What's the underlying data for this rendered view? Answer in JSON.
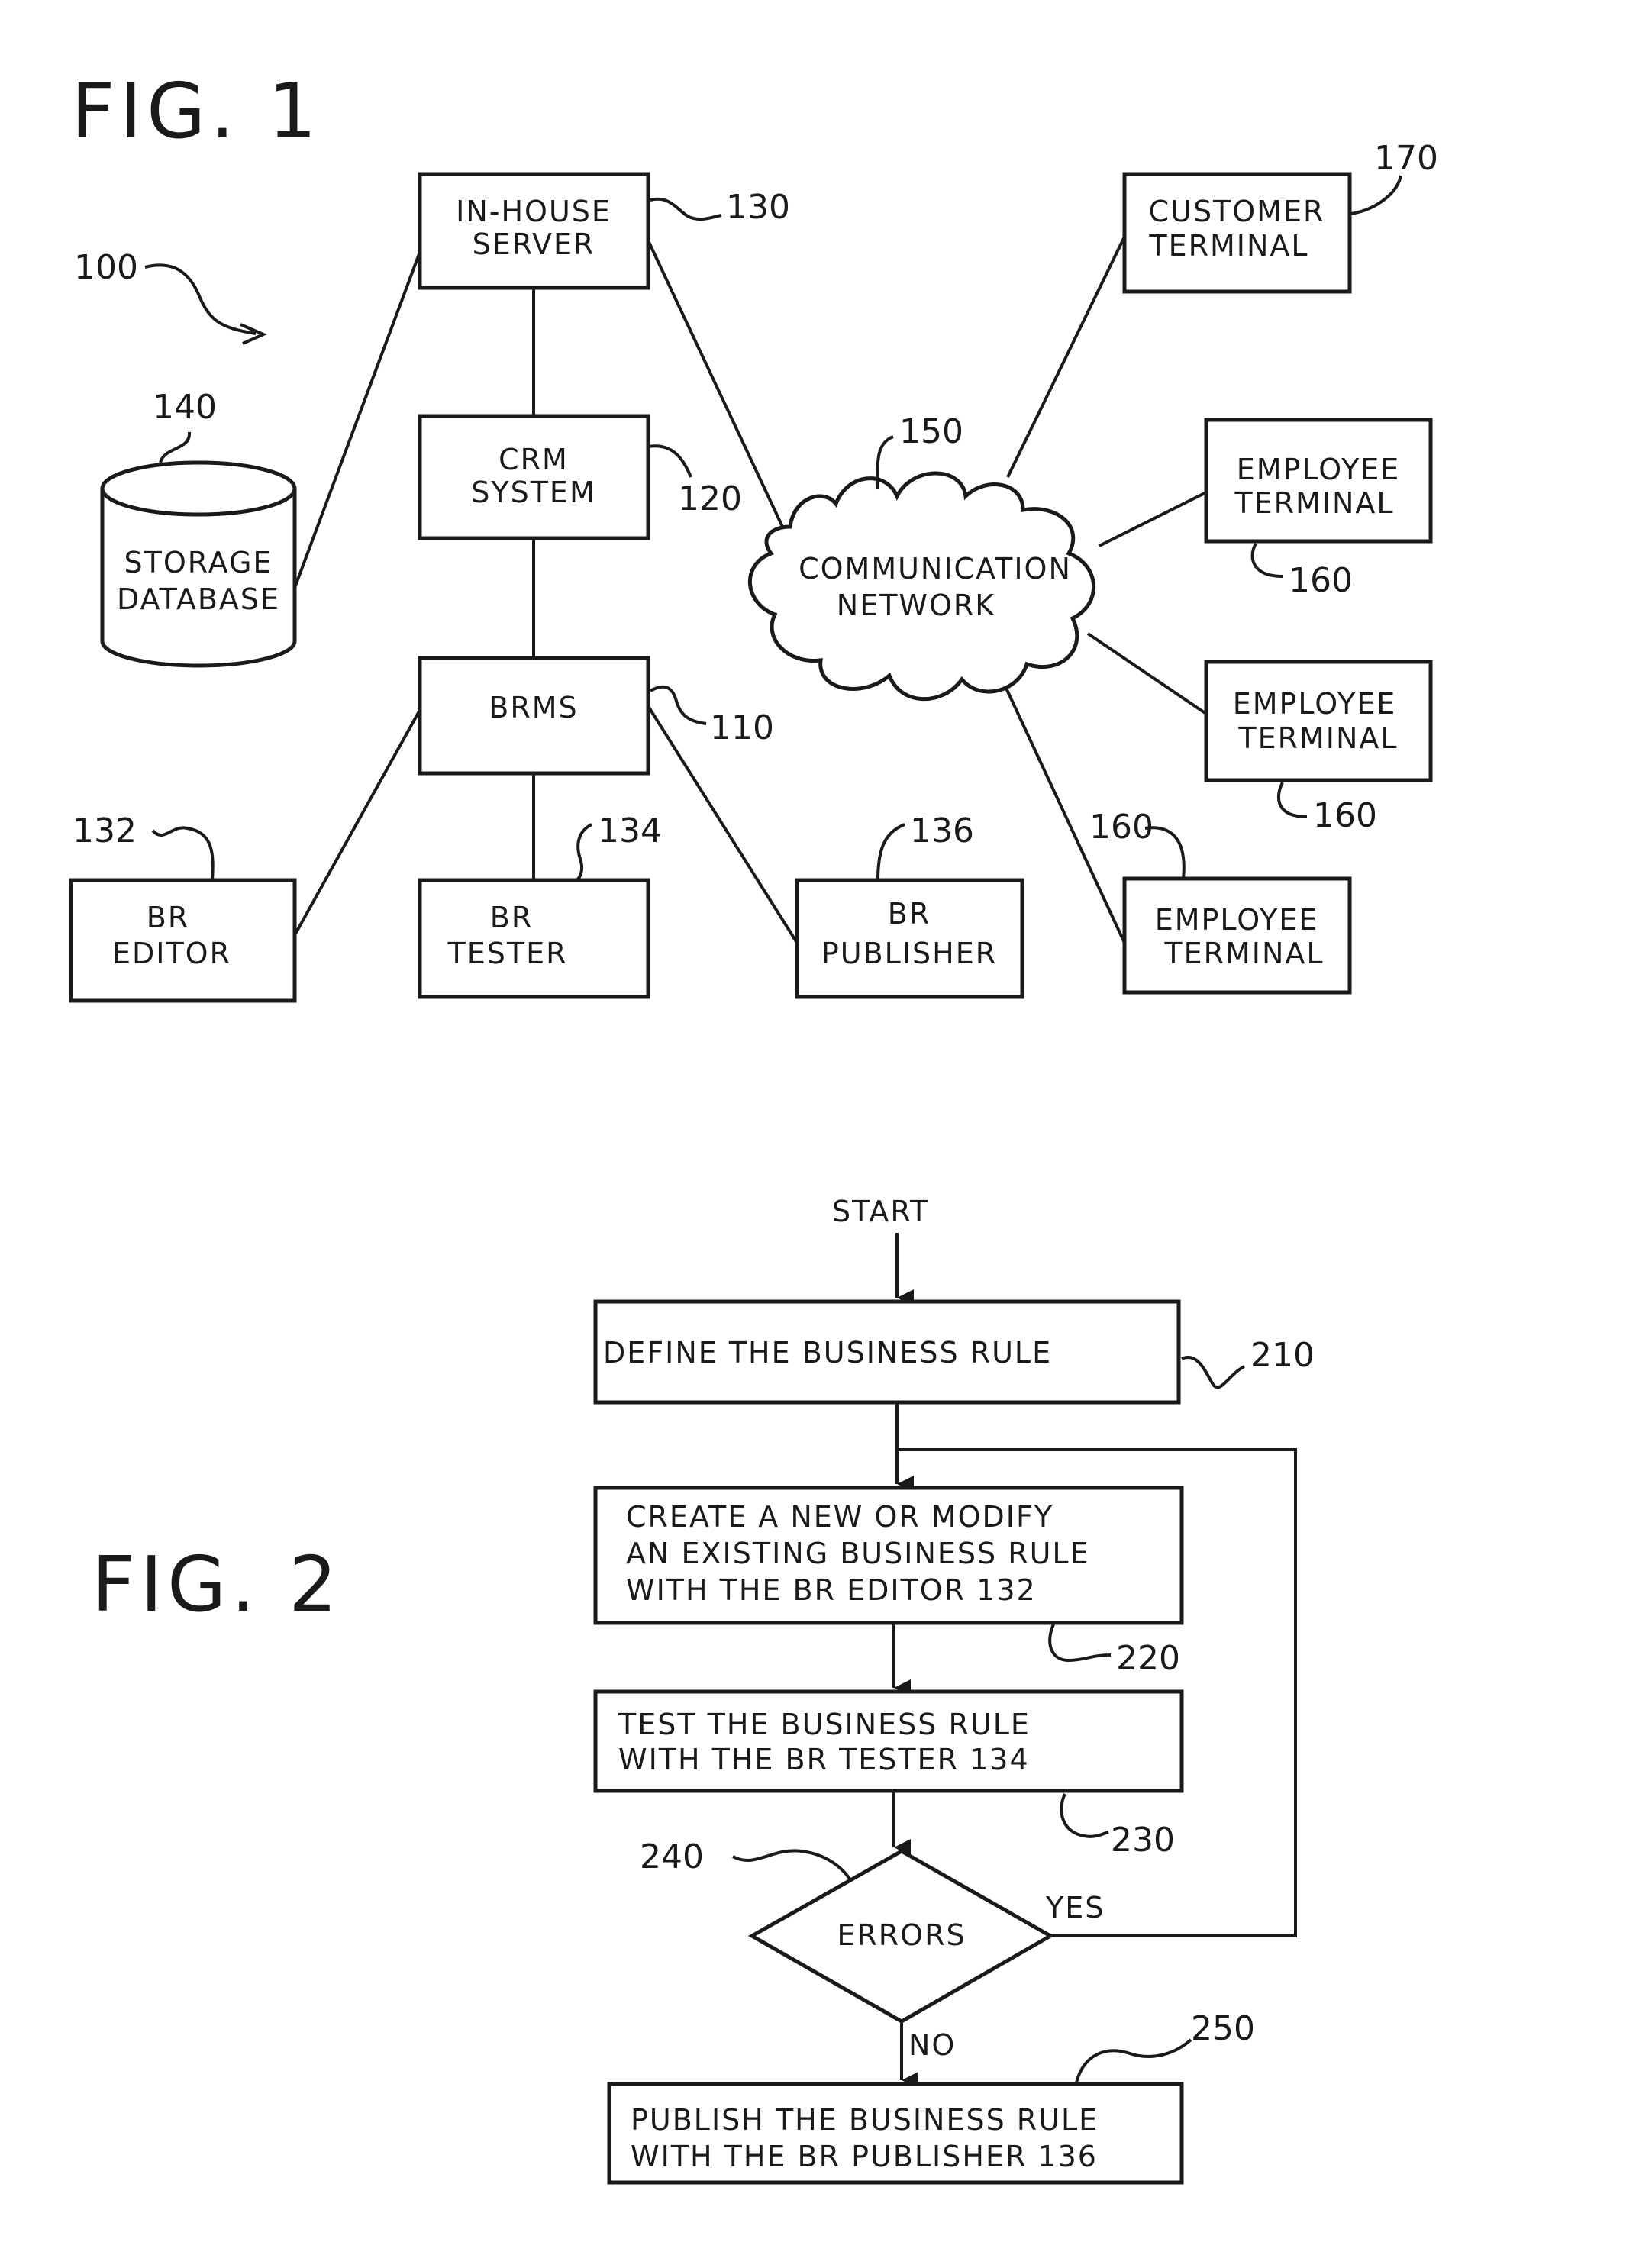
{
  "fig1": {
    "title": "FIG. 1",
    "system_ref": "100",
    "nodes": {
      "in_house_server": {
        "lines": [
          "IN-HOUSE",
          "SERVER"
        ],
        "ref": "130"
      },
      "crm_system": {
        "lines": [
          "CRM",
          "SYSTEM"
        ],
        "ref": "120"
      },
      "storage_database": {
        "lines": [
          "STORAGE",
          "DATABASE"
        ],
        "ref": "140"
      },
      "brms": {
        "lines": [
          "BRMS"
        ],
        "ref": "110"
      },
      "br_editor": {
        "lines": [
          "BR",
          "EDITOR"
        ],
        "ref": "132"
      },
      "br_tester": {
        "lines": [
          "BR",
          "TESTER"
        ],
        "ref": "134"
      },
      "br_publisher": {
        "lines": [
          "BR",
          "PUBLISHER"
        ],
        "ref": "136"
      },
      "communication_network": {
        "lines": [
          "COMMUNICATION",
          "NETWORK"
        ],
        "ref": "150"
      },
      "customer_terminal": {
        "lines": [
          "CUSTOMER",
          "TERMINAL"
        ],
        "ref": "170"
      },
      "employee_terminal_1": {
        "lines": [
          "EMPLOYEE",
          "TERMINAL"
        ],
        "ref": "160"
      },
      "employee_terminal_2": {
        "lines": [
          "EMPLOYEE",
          "TERMINAL"
        ],
        "ref": "160"
      },
      "employee_terminal_3": {
        "lines": [
          "EMPLOYEE",
          "TERMINAL"
        ],
        "ref": "160"
      }
    }
  },
  "fig2": {
    "title": "FIG. 2",
    "start": "START",
    "steps": {
      "define": {
        "lines": [
          "DEFINE THE BUSINESS RULE"
        ],
        "ref": "210"
      },
      "create": {
        "lines": [
          "CREATE A NEW OR MODIFY",
          "AN EXISTING BUSINESS RULE",
          "WITH THE BR EDITOR  132"
        ],
        "ref": "220"
      },
      "test": {
        "lines": [
          "TEST THE BUSINESS RULE",
          "WITH  THE BR TESTER 134"
        ],
        "ref": "230"
      },
      "decision": {
        "lines": [
          "ERRORS"
        ],
        "ref": "240",
        "yes": "YES",
        "no": "NO"
      },
      "publish": {
        "lines": [
          "PUBLISH THE BUSINESS RULE",
          "WITH THE BR PUBLISHER  136"
        ],
        "ref": "250"
      }
    }
  }
}
